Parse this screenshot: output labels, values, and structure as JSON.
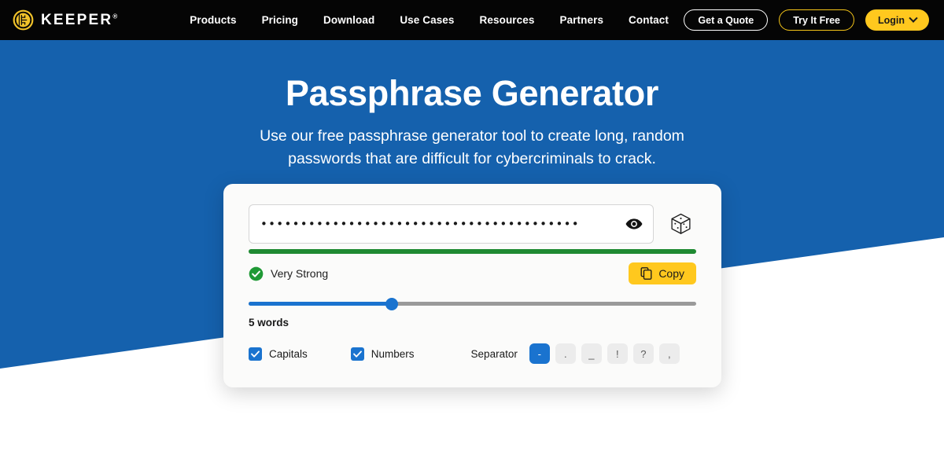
{
  "nav": {
    "brand": {
      "name": "KEEPER",
      "trademark": "®",
      "icon": "keeper-logo-icon"
    },
    "links": [
      {
        "label": "Products"
      },
      {
        "label": "Pricing"
      },
      {
        "label": "Download"
      },
      {
        "label": "Use Cases"
      },
      {
        "label": "Resources"
      },
      {
        "label": "Partners"
      },
      {
        "label": "Contact"
      }
    ],
    "actions": {
      "quote_label": "Get a Quote",
      "try_label": "Try It Free",
      "login_label": "Login",
      "login_chevron_icon": "chevron-down-icon"
    }
  },
  "hero": {
    "title": "Passphrase Generator",
    "subtitle": "Use our free passphrase generator tool to create long, random passwords that are difficult for cybercriminals to crack."
  },
  "generator": {
    "password_masked": "••••••••••••••••••••••••••••••••••••••••",
    "password_visible": false,
    "toggle_visibility_icon": "eye-icon",
    "regenerate_icon": "dice-icon",
    "strength": {
      "label": "Very Strong",
      "check_icon": "check-circle-icon",
      "bar_percent": 100,
      "bar_color": "#1f8a32"
    },
    "copy": {
      "label": "Copy",
      "icon": "copy-icon",
      "color": "#ffc81e"
    },
    "slider": {
      "value_label": "5 words",
      "value": 5,
      "percent": 32,
      "fill_color": "#1a73cf",
      "track_color": "#9a9a9a"
    },
    "options": [
      {
        "label": "Capitals",
        "checked": true
      },
      {
        "label": "Numbers",
        "checked": true
      }
    ],
    "separator": {
      "label": "Separator",
      "selected": "-",
      "choices": [
        "-",
        ".",
        "_",
        "!",
        "?",
        ","
      ]
    }
  },
  "theme": {
    "nav_bg": "#050505",
    "hero_bg": "#1561ad",
    "accent_yellow": "#ffc81e",
    "accent_blue": "#1a73cf",
    "success_green": "#1f8a32"
  }
}
